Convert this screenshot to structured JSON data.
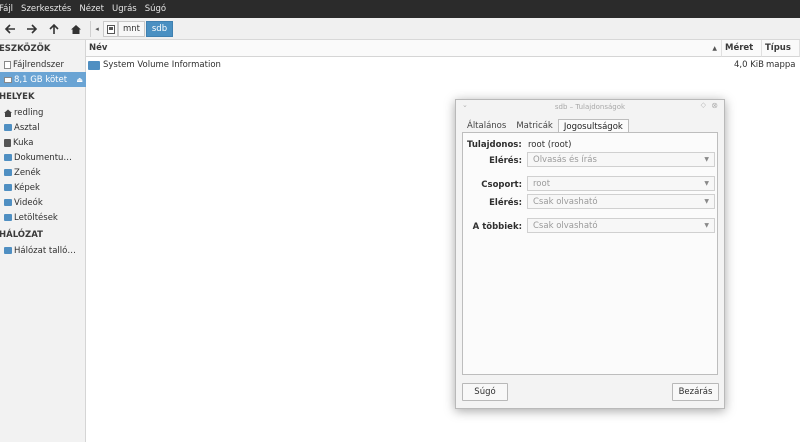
{
  "menubar": {
    "items": [
      "Fájl",
      "Szerkesztés",
      "Nézet",
      "Ugrás",
      "Súgó"
    ]
  },
  "toolbar": {
    "icons": [
      "back-icon",
      "forward-icon",
      "up-icon",
      "home-icon"
    ],
    "breadcrumb": [
      "mnt",
      "sdb"
    ]
  },
  "sidebar": {
    "sections": [
      {
        "title": "ESZKÖZÖK"
      },
      {
        "title": "HELYEK"
      },
      {
        "title": "HÁLÓZAT"
      }
    ],
    "devices": [
      "Fájlrendszer",
      "8,1 GB kötet"
    ],
    "places": [
      "redling",
      "Asztal",
      "Kuka",
      "Dokumentu…",
      "Zenék",
      "Képek",
      "Videók",
      "Letöltések"
    ],
    "network": [
      "Hálózat talló…"
    ]
  },
  "list": {
    "columns": {
      "name": "Név",
      "size": "Méret",
      "type": "Típus"
    },
    "rows": [
      {
        "name": "System Volume Information",
        "size": "4,0 KiB",
        "type": "mappa"
      }
    ]
  },
  "dialog": {
    "title": "sdb – Tulajdonságok",
    "tabs": [
      "Általános",
      "Matricák",
      "Jogosultságok"
    ],
    "owner_label": "Tulajdonos:",
    "owner_value": "root (root)",
    "owner_access_label": "Elérés:",
    "owner_access_value": "Olvasás és írás",
    "group_label": "Csoport:",
    "group_value": "root",
    "group_access_label": "Elérés:",
    "group_access_value": "Csak olvasható",
    "others_label": "A többiek:",
    "others_value": "Csak olvasható",
    "help_button": "Súgó",
    "close_button": "Bezárás"
  },
  "colors": {
    "accent": "#4a90c2",
    "menubar": "#2b2b2b",
    "selected": "#6aa4d4"
  }
}
